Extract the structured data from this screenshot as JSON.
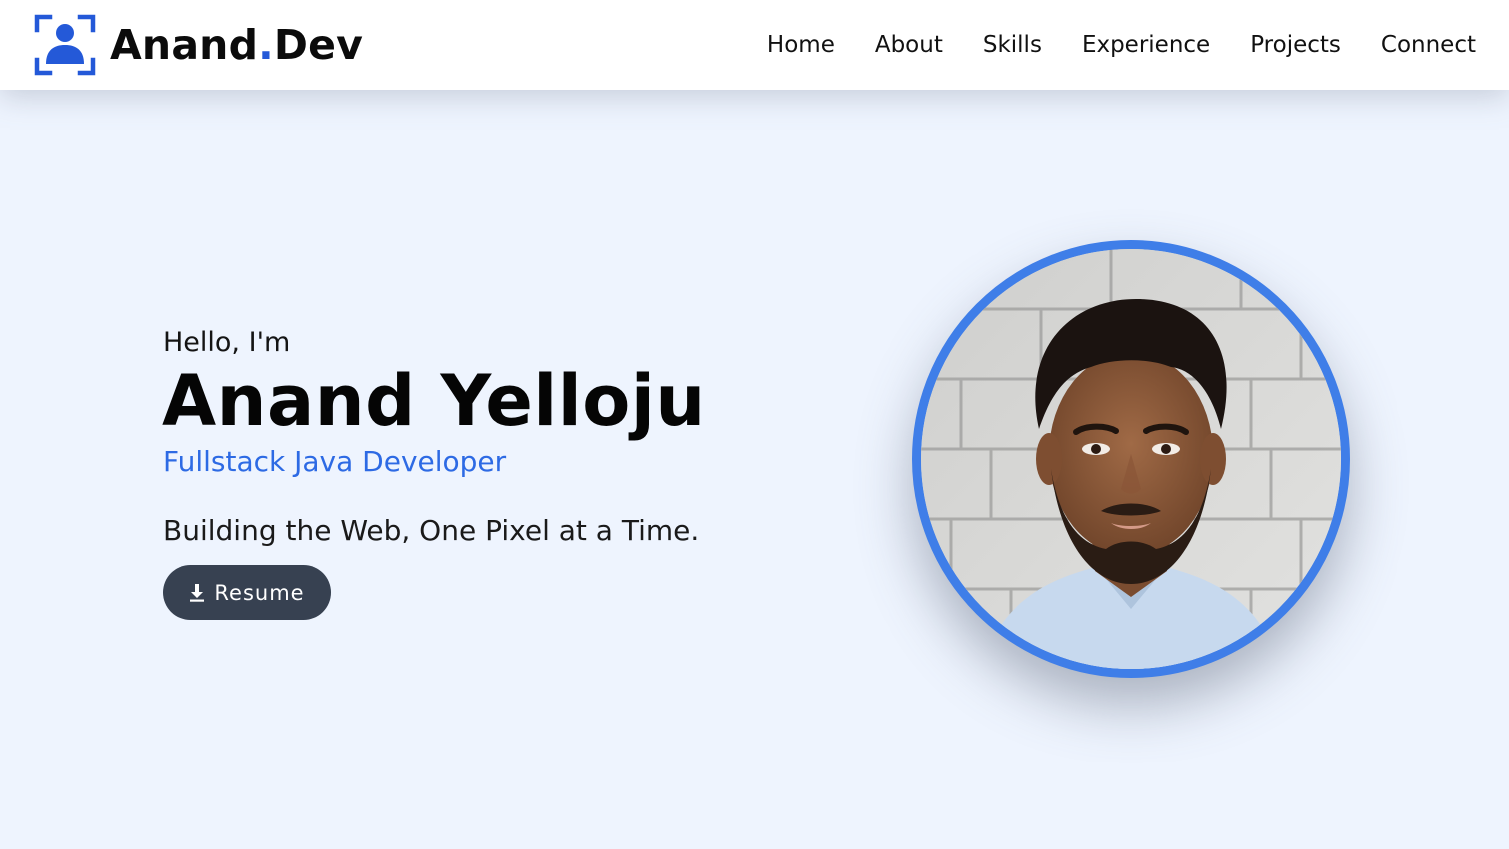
{
  "brand": {
    "name": "Anand",
    "dot": ".",
    "suffix": "Dev",
    "accent_color": "#2459d8",
    "icon": "user-focus-icon"
  },
  "nav": {
    "items": [
      {
        "label": "Home"
      },
      {
        "label": "About"
      },
      {
        "label": "Skills"
      },
      {
        "label": "Experience"
      },
      {
        "label": "Projects"
      },
      {
        "label": "Connect"
      }
    ]
  },
  "hero": {
    "greeting": "Hello, I'm",
    "name": "Anand Yelloju",
    "role": "Fullstack Java Developer",
    "tagline": "Building the Web, One Pixel at a Time.",
    "resume_label": "Resume",
    "resume_icon": "download-icon",
    "role_color": "#2d6ae4",
    "button_color": "#374151",
    "avatar_border_color": "#3f7ee8",
    "background_color": "#eef4fe"
  }
}
